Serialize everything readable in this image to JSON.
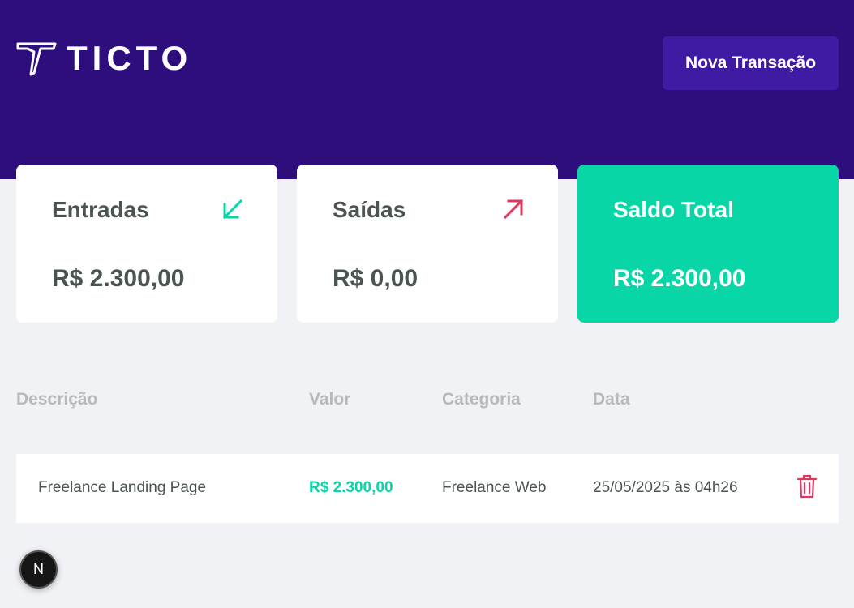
{
  "header": {
    "logo_text": "TICTO",
    "new_transaction_label": "Nova Transação"
  },
  "summary": {
    "income": {
      "title": "Entradas",
      "value": "R$ 2.300,00",
      "icon": "arrow-down-left-icon",
      "color": "#08d6a6"
    },
    "outcome": {
      "title": "Saídas",
      "value": "R$ 0,00",
      "icon": "arrow-up-right-icon",
      "color": "#e0375f"
    },
    "total": {
      "title": "Saldo Total",
      "value": "R$ 2.300,00",
      "color": "#08d6a6"
    }
  },
  "table": {
    "headers": [
      "Descrição",
      "Valor",
      "Categoria",
      "Data"
    ],
    "rows": [
      {
        "description": "Freelance Landing Page",
        "value": "R$ 2.300,00",
        "category": "Freelance Web",
        "date": "25/05/2025 às 04h26",
        "action_icon": "trash-icon"
      }
    ]
  },
  "dev_badge": {
    "label": "N"
  },
  "colors": {
    "header_bg": "#2e0d7d",
    "button_bg": "#3f1aa3",
    "accent_green": "#08d6a6",
    "accent_red": "#e0375f",
    "page_bg": "#f0f2f5"
  }
}
